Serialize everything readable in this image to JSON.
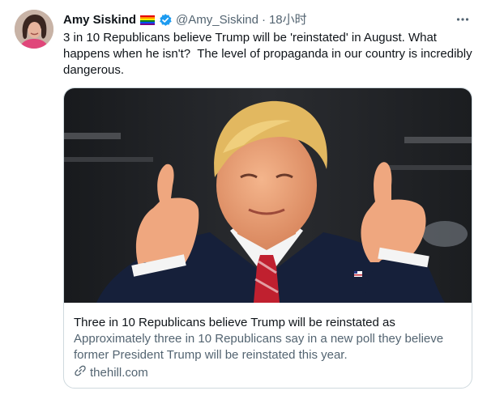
{
  "author": {
    "name": "Amy Siskind",
    "handle": "@Amy_Siskind",
    "separator": "·",
    "time": "18小时"
  },
  "icons": {
    "flag": "rainbow-flag-icon",
    "verified": "verified-badge-icon",
    "more": "more-options-icon",
    "link": "link-icon"
  },
  "colors": {
    "verified": "#1d9bf0",
    "secondary_text": "#536471",
    "border": "#cfd9de"
  },
  "tweet": {
    "text": "3 in 10 Republicans believe Trump will be 'reinstated' in August. What happens when he isn't?  The level of propaganda in our country is incredibly dangerous."
  },
  "card": {
    "title": "Three in 10 Republicans believe Trump will be reinstated as",
    "description": "Approximately three in 10 Republicans say in a new poll they believe former President Trump will be reinstated this year.",
    "domain": "thehill.com"
  }
}
